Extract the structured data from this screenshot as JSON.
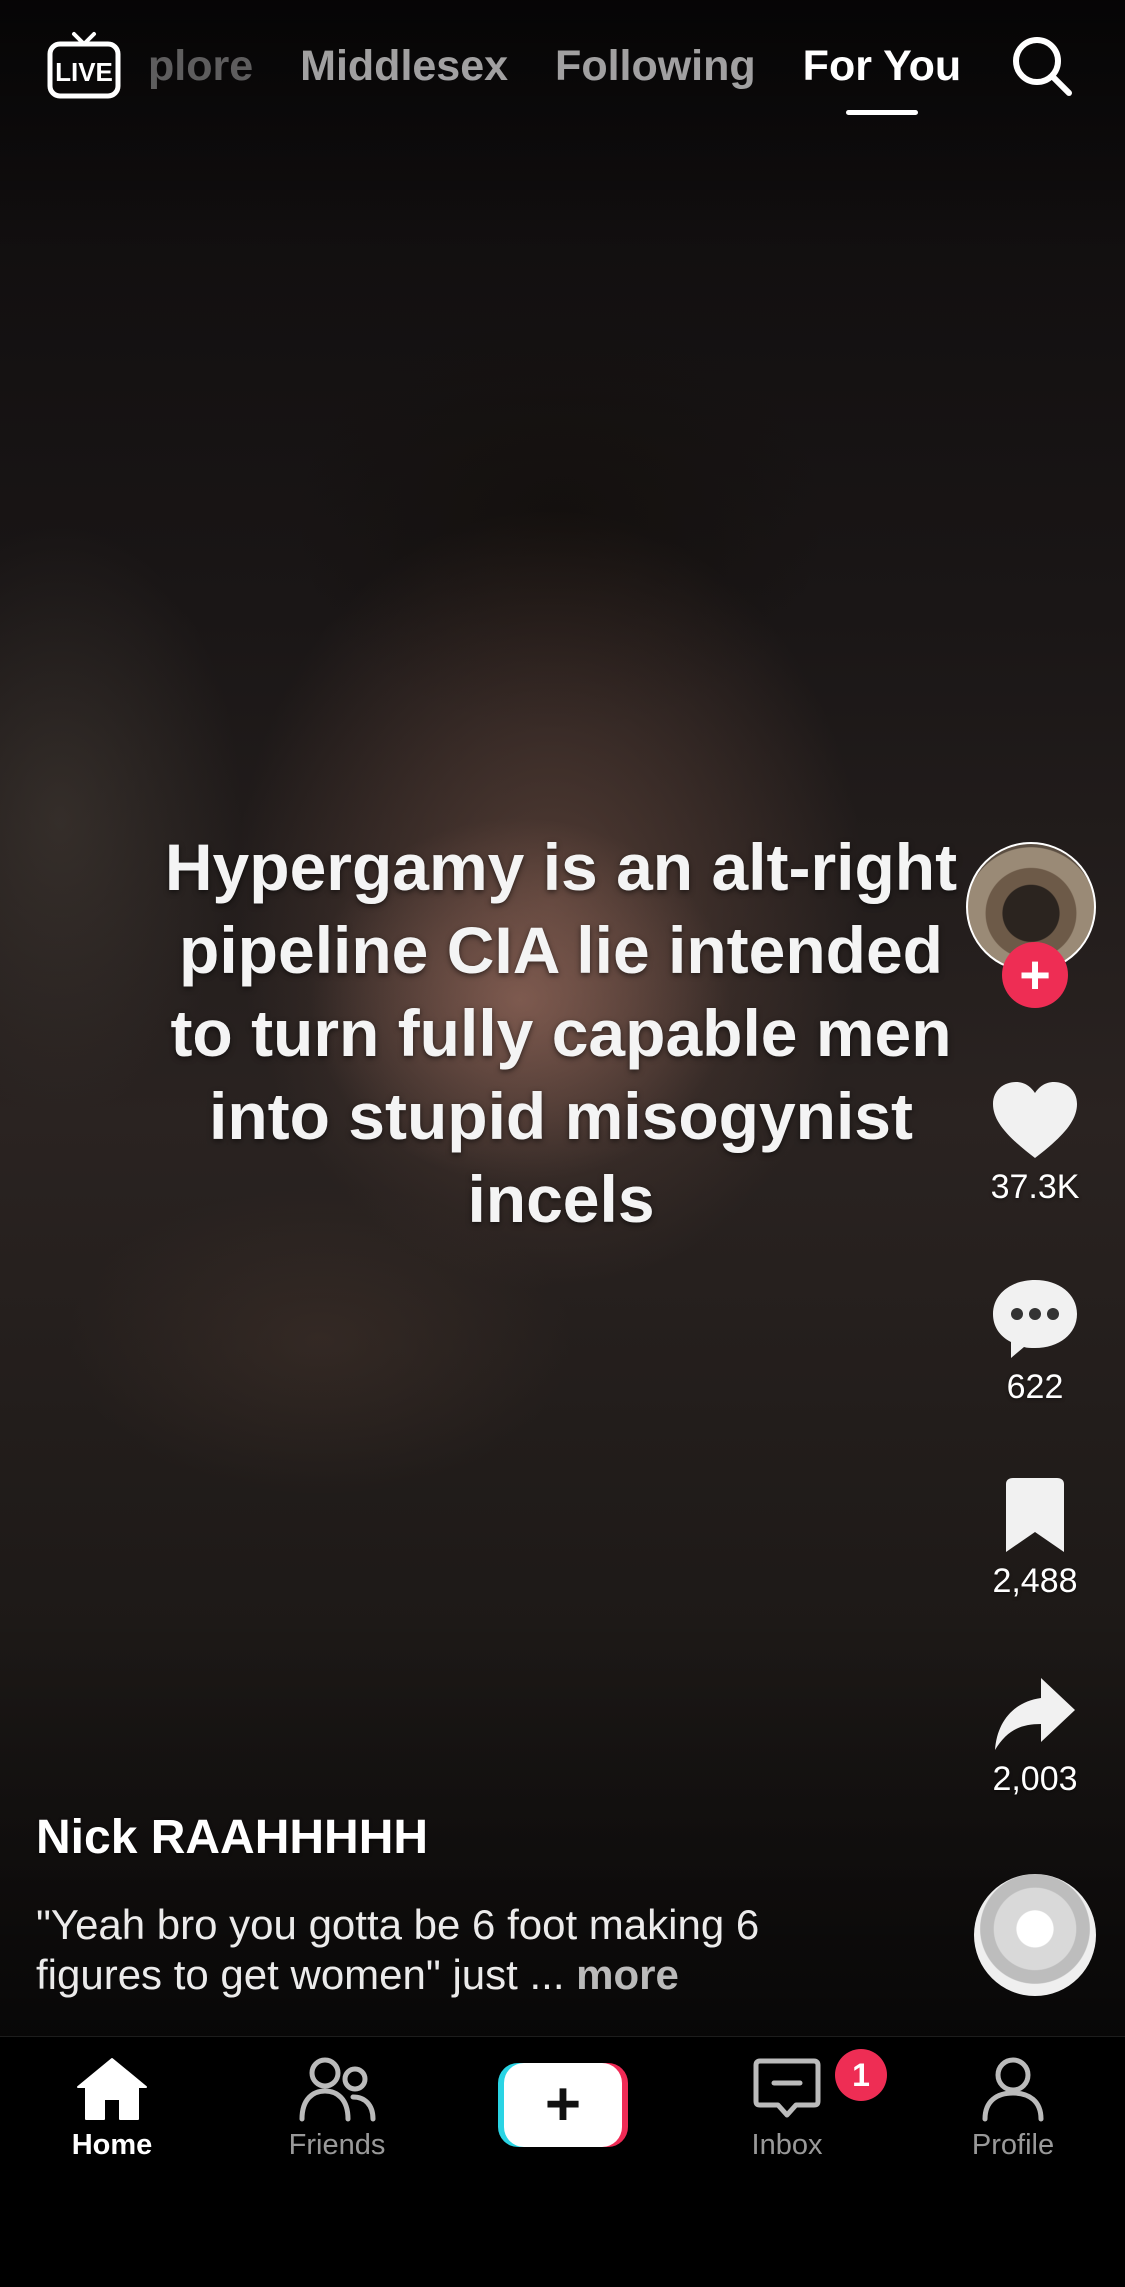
{
  "top_nav": {
    "live_label": "LIVE",
    "tabs": [
      {
        "label": "plore"
      },
      {
        "label": "Middlesex"
      },
      {
        "label": "Following"
      },
      {
        "label": "For You"
      }
    ]
  },
  "video": {
    "overlay_text": "Hypergamy is an alt-right pipeline CIA lie intended to turn fully capable men into stupid misogynist incels"
  },
  "actions": {
    "likes": "37.3K",
    "comments": "622",
    "saves": "2,488",
    "shares": "2,003"
  },
  "post": {
    "username": "Nick RAAHHHHH",
    "caption": "\"Yeah bro you gotta be 6 foot making 6 figures to get women\" just ...",
    "more_label": "more"
  },
  "bottom_nav": {
    "home": "Home",
    "friends": "Friends",
    "inbox": "Inbox",
    "inbox_badge": "1",
    "profile": "Profile"
  },
  "colors": {
    "accent_red": "#ee2d54",
    "accent_cyan": "#2ad4e4",
    "background": "#000000"
  },
  "icons": [
    "live-icon",
    "search-icon",
    "plus-icon",
    "heart-icon",
    "comment-icon",
    "bookmark-icon",
    "share-icon",
    "home-icon",
    "friends-icon",
    "create-icon",
    "inbox-icon",
    "profile-icon"
  ]
}
